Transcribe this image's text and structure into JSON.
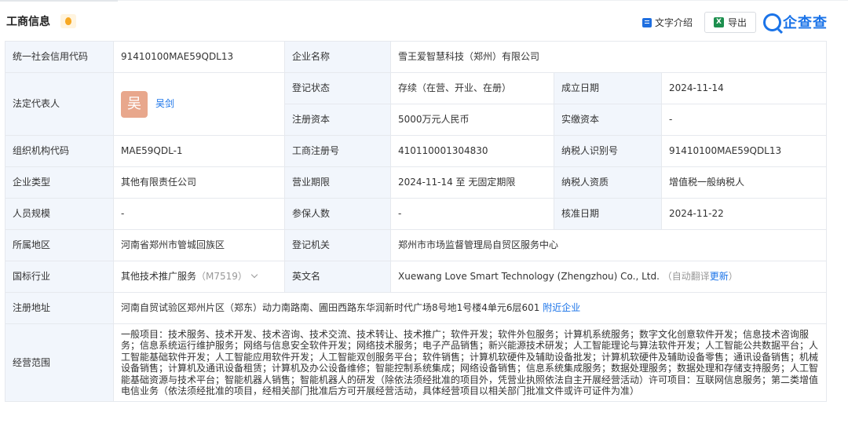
{
  "header": {
    "title": "工商信息",
    "intro_label": "文字介绍",
    "export_label": "导出",
    "logo_text": "企查查",
    "excel_icon_glyph": "X"
  },
  "table": {
    "credit_code_label": "统一社会信用代码",
    "credit_code": "91410100MAE59QDL13",
    "company_name_label": "企业名称",
    "company_name": "雪王爱智慧科技（郑州）有限公司",
    "legal_rep_label": "法定代表人",
    "legal_rep_avatar": "吴",
    "legal_rep_name": "吴剑",
    "status_label": "登记状态",
    "status": "存续（在营、开业、在册）",
    "founded_label": "成立日期",
    "founded": "2024-11-14",
    "reg_capital_label": "注册资本",
    "reg_capital": "5000万元人民币",
    "paid_capital_label": "实缴资本",
    "paid_capital": "-",
    "org_code_label": "组织机构代码",
    "org_code": "MAE59QDL-1",
    "biz_reg_no_label": "工商注册号",
    "biz_reg_no": "410110001304830",
    "taxpayer_id_label": "纳税人识别号",
    "taxpayer_id": "91410100MAE59QDL13",
    "company_type_label": "企业类型",
    "company_type": "其他有限责任公司",
    "term_label": "营业期限",
    "term": "2024-11-14 至 无固定期限",
    "taxpayer_qual_label": "纳税人资质",
    "taxpayer_qual": "增值税一般纳税人",
    "staff_size_label": "人员规模",
    "staff_size": "-",
    "insured_label": "参保人数",
    "insured": "-",
    "approval_date_label": "核准日期",
    "approval_date": "2024-11-22",
    "region_label": "所属地区",
    "region": "河南省郑州市管城回族区",
    "reg_authority_label": "登记机关",
    "reg_authority": "郑州市市场监督管理局自贸区服务中心",
    "industry_label": "国标行业",
    "industry": "其他技术推广服务",
    "industry_code": "（M7519）",
    "english_name_label": "英文名",
    "english_name": "Xuewang Love Smart Technology (Zhengzhou) Co., Ltd.",
    "auto_translate": "（自动翻译",
    "update_link": "更新",
    "auto_translate_end": "）",
    "address_label": "注册地址",
    "address": "河南自贸试验区郑州片区（郑东）动力南路南、圃田西路东华润新时代广场8号地1号楼4单元6层601",
    "nearby_link": "附近企业",
    "scope_label": "经营范围",
    "scope": "一般项目：技术服务、技术开发、技术咨询、技术交流、技术转让、技术推广；软件开发；软件外包服务；计算机系统服务；数字文化创意软件开发；信息技术咨询服务；信息系统运行维护服务；网络与信息安全软件开发；网络技术服务；电子产品销售；新兴能源技术研发；人工智能理论与算法软件开发；人工智能公共数据平台；人工智能基础软件开发；人工智能应用软件开发；人工智能双创服务平台；软件销售；计算机软硬件及辅助设备批发；计算机软硬件及辅助设备零售；通讯设备销售；机械设备销售；计算机及通讯设备租赁；计算机及办公设备维修；智能控制系统集成；网络设备销售；信息系统集成服务；数据处理服务；数据处理和存储支持服务；人工智能基础资源与技术平台；智能机器人销售；智能机器人的研发（除依法须经批准的项目外，凭营业执照依法自主开展经营活动）许可项目：互联网信息服务；第二类增值电信业务（依法须经批准的项目，经相关部门批准后方可开展经营活动，具体经营项目以相关部门批准文件或许可证件为准）"
  },
  "colors": {
    "label_bg": "#f2f6fc",
    "border": "#e6e9ee",
    "link": "#1a73e8",
    "avatar_bg": "#e8a78c"
  },
  "icons": [
    "badge-icon",
    "document-icon",
    "excel-icon",
    "search-logo-icon",
    "chevron-down-icon"
  ]
}
